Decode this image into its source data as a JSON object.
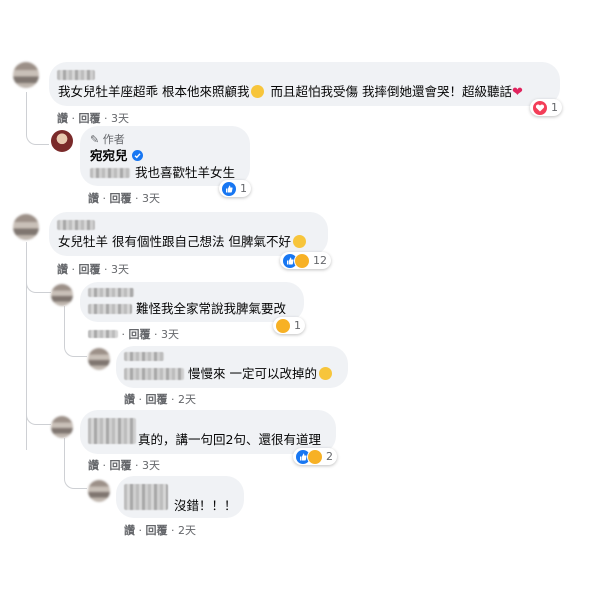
{
  "actions": {
    "like": "讚",
    "reply": "回覆"
  },
  "comments": [
    {
      "text_a": "我女兒牡羊座超乖 根本他來照顧我",
      "text_b": "而且超怕我受傷 我摔倒她還會哭！超級聽話",
      "time": "3天",
      "react_count": "1"
    },
    {
      "badge": "作者",
      "author": "宛宛兒",
      "text": "我也喜歡牡羊女生",
      "time": "3天",
      "react_count": "1"
    },
    {
      "text": "女兒牡羊 很有個性跟自己想法 但脾氣不好",
      "time": "3天",
      "react_count": "12"
    },
    {
      "text": "難怪我全家常說我脾氣要改",
      "time": "3天",
      "react_count": "1"
    },
    {
      "text": "慢慢來 一定可以改掉的",
      "time": "2天"
    },
    {
      "text": "真的，講一句回2句、還很有道理",
      "time": "3天",
      "react_count": "2"
    },
    {
      "text": "沒錯！！！",
      "time": "2天"
    }
  ],
  "colors": {
    "bubble": "#f0f2f5",
    "meta": "#65676b",
    "like_blue": "#1877f2",
    "love_red": "#f33e58",
    "haha_yellow": "#f7b125"
  }
}
